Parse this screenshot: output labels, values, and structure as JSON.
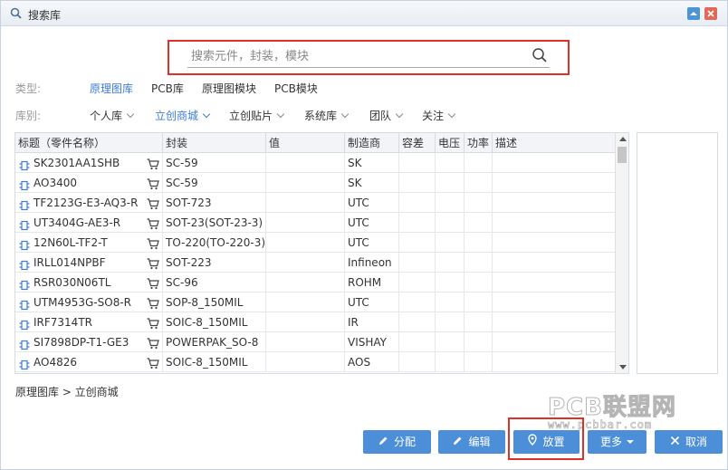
{
  "window": {
    "title": "搜索库"
  },
  "search": {
    "placeholder": "搜索元件，封装，模块"
  },
  "type_filter": {
    "label": "类型:",
    "items": [
      "原理图库",
      "PCB库",
      "原理图模块",
      "PCB模块"
    ],
    "active": "原理图库"
  },
  "library_filter": {
    "label": "库别:",
    "items": [
      "个人库",
      "立创商城",
      "立创贴片",
      "系统库",
      "团队",
      "关注"
    ],
    "active": "立创商城"
  },
  "table": {
    "columns": [
      "标题（零件名称）",
      "封装",
      "值",
      "制造商",
      "容差",
      "电压",
      "功率",
      "描述"
    ],
    "rows": [
      {
        "title": "SK2301AA1SHB",
        "package": "SC-59",
        "value": "",
        "manufacturer": "SK"
      },
      {
        "title": "AO3400",
        "package": "SC-59",
        "value": "",
        "manufacturer": "SK"
      },
      {
        "title": "TF2123G-E3-AQ3-R",
        "package": "SOT-723",
        "value": "",
        "manufacturer": "UTC"
      },
      {
        "title": "UT3404G-AE3-R",
        "package": "SOT-23(SOT-23-3)",
        "value": "",
        "manufacturer": "UTC"
      },
      {
        "title": "12N60L-TF2-T",
        "package": "TO-220(TO-220-3)",
        "value": "",
        "manufacturer": "UTC"
      },
      {
        "title": "IRLL014NPBF",
        "package": "SOT-223",
        "value": "",
        "manufacturer": "Infineon"
      },
      {
        "title": "RSR030N06TL",
        "package": "SC-96",
        "value": "",
        "manufacturer": "ROHM"
      },
      {
        "title": "UTM4953G-SO8-R",
        "package": "SOP-8_150MIL",
        "value": "",
        "manufacturer": "UTC"
      },
      {
        "title": "IRF7314TR",
        "package": "SOIC-8_150MIL",
        "value": "",
        "manufacturer": "IR"
      },
      {
        "title": "SI7898DP-T1-GE3",
        "package": "POWERPAK_SO-8",
        "value": "",
        "manufacturer": "VISHAY"
      },
      {
        "title": "AO4826",
        "package": "SOIC-8_150MIL",
        "value": "",
        "manufacturer": "AOS"
      }
    ]
  },
  "breadcrumb": "原理图库 > 立创商城",
  "watermark": {
    "main": "PCB联盟网",
    "sub": "www.pcbbar.com"
  },
  "buttons": {
    "assign": "分配",
    "edit": "编辑",
    "place": "放置",
    "more": "更多",
    "cancel": "取消"
  },
  "colors": {
    "accent": "#4c8fd8",
    "active_link": "#3d7bd9",
    "highlight": "#e0302a"
  }
}
